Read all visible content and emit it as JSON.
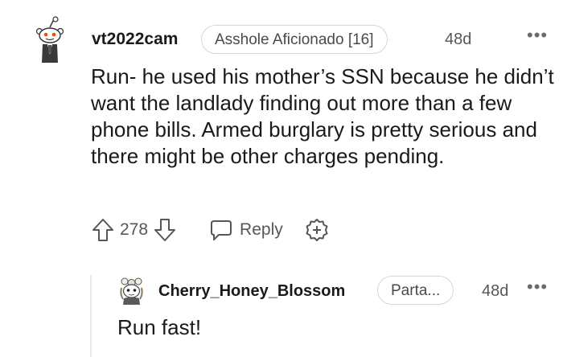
{
  "comment": {
    "username": "vt2022cam",
    "flair": "Asshole Aficionado [16]",
    "age": "48d",
    "more": "•••",
    "body": "Run- he used his mother’s SSN because he didn’t want the landlady finding out more than a few phone bills. Armed burglary is pretty serious and there might be other charges pending.",
    "votes": "278",
    "reply_label": "Reply",
    "icons": [
      "snoo-avatar",
      "upvote-icon",
      "downvote-icon",
      "reply-icon",
      "award-icon",
      "more-options-icon"
    ]
  },
  "reply": {
    "username": "Cherry_Honey_Blossom",
    "flair": "Parta...",
    "age": "48d",
    "more": "•••",
    "body": "Run fast!",
    "icons": [
      "user-avatar",
      "more-options-icon"
    ]
  },
  "colors": {
    "text": "#1a1a1b",
    "meta": "#575757",
    "border": "#d6d6d6",
    "snoo_orange": "#ff4500"
  }
}
